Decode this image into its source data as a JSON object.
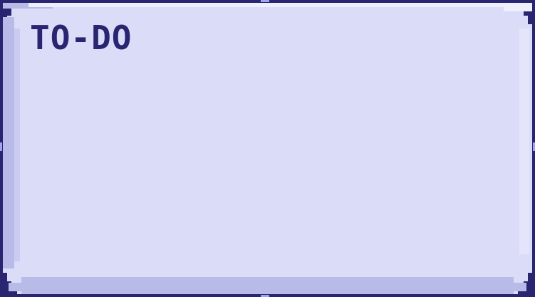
{
  "card": {
    "title": "TO-DO"
  },
  "colors": {
    "frame": "#2a2570",
    "panel": "#dbdcf7",
    "shade": "#b8bbe8",
    "highlight": "#eeeefc",
    "title_text": "#2a2570"
  }
}
